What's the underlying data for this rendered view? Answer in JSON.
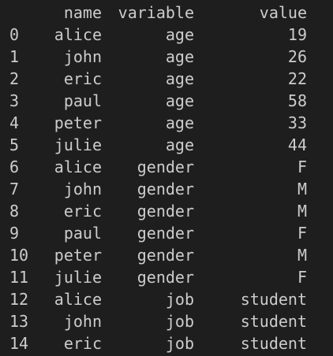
{
  "table": {
    "columns": [
      "name",
      "variable",
      "value"
    ],
    "rows": [
      {
        "index": "0",
        "name": "alice",
        "variable": "age",
        "value": "19"
      },
      {
        "index": "1",
        "name": "john",
        "variable": "age",
        "value": "26"
      },
      {
        "index": "2",
        "name": "eric",
        "variable": "age",
        "value": "22"
      },
      {
        "index": "3",
        "name": "paul",
        "variable": "age",
        "value": "58"
      },
      {
        "index": "4",
        "name": "peter",
        "variable": "age",
        "value": "33"
      },
      {
        "index": "5",
        "name": "julie",
        "variable": "age",
        "value": "44"
      },
      {
        "index": "6",
        "name": "alice",
        "variable": "gender",
        "value": "F"
      },
      {
        "index": "7",
        "name": "john",
        "variable": "gender",
        "value": "M"
      },
      {
        "index": "8",
        "name": "eric",
        "variable": "gender",
        "value": "M"
      },
      {
        "index": "9",
        "name": "paul",
        "variable": "gender",
        "value": "F"
      },
      {
        "index": "10",
        "name": "peter",
        "variable": "gender",
        "value": "M"
      },
      {
        "index": "11",
        "name": "julie",
        "variable": "gender",
        "value": "F"
      },
      {
        "index": "12",
        "name": "alice",
        "variable": "job",
        "value": "student"
      },
      {
        "index": "13",
        "name": "john",
        "variable": "job",
        "value": "student"
      },
      {
        "index": "14",
        "name": "eric",
        "variable": "job",
        "value": "student"
      }
    ]
  },
  "colors": {
    "background": "#1e1e1e",
    "text": "#cccccc"
  }
}
